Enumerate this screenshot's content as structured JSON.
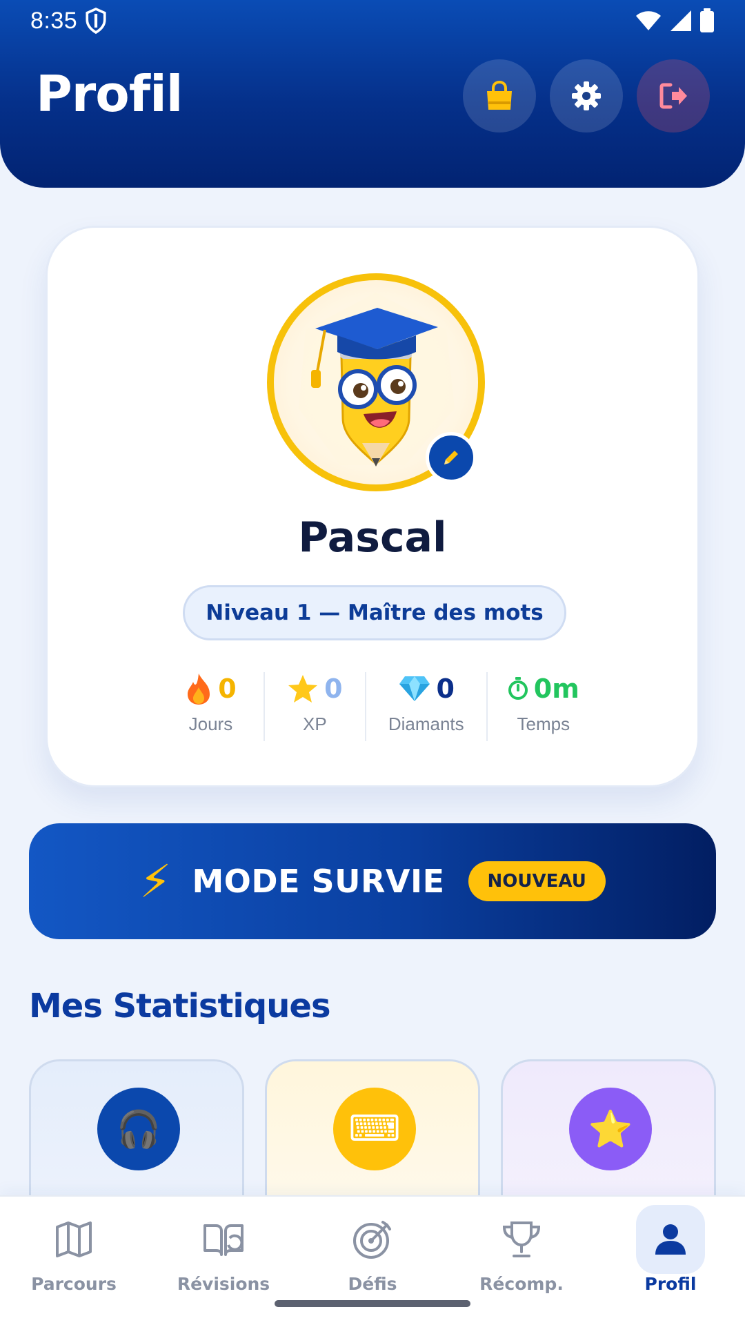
{
  "status": {
    "time": "8:35"
  },
  "header": {
    "title": "Profil",
    "icons": [
      "shopping-bag-icon",
      "gear-icon",
      "logout-icon"
    ]
  },
  "profile": {
    "name": "Pascal",
    "level": "Niveau 1 — Maître des mots",
    "stats": [
      {
        "icon": "fire-icon",
        "value": "0",
        "label": "Jours",
        "color": "#f5b400"
      },
      {
        "icon": "star-icon",
        "value": "0",
        "label": "XP",
        "color": "#8fb4ee"
      },
      {
        "icon": "diamond-icon",
        "value": "0",
        "label": "Diamants",
        "color": "#0b2f8a"
      },
      {
        "icon": "stopwatch-icon",
        "value": "0m",
        "label": "Temps",
        "color": "#22c55e"
      }
    ]
  },
  "survie": {
    "label": "MODE SURVIE",
    "badge": "NOUVEAU",
    "bolt": "⚡"
  },
  "stats_section": {
    "title": "Mes Statistiques"
  },
  "tiles": [
    {
      "icon": "headphones-icon",
      "glyph": "🎧",
      "bg": "#0b48ad"
    },
    {
      "icon": "keyboard-icon",
      "glyph": "⌨",
      "bg": "#ffc10a"
    },
    {
      "icon": "star-icon",
      "glyph": "⭐",
      "bg": "#8b5cf6"
    }
  ],
  "nav": {
    "items": [
      {
        "label": "Parcours"
      },
      {
        "label": "Révisions"
      },
      {
        "label": "Défis"
      },
      {
        "label": "Récomp."
      },
      {
        "label": "Profil"
      }
    ],
    "active": "Profil"
  },
  "colors": {
    "primary": "#0b3aa0",
    "accent": "#ffc10a"
  }
}
